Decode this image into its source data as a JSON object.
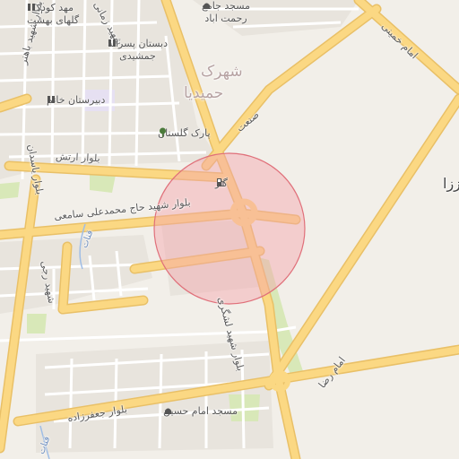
{
  "map": {
    "colors": {
      "background": "#f2efe9",
      "block": "#e8e4dd",
      "road_major": "#fbd883",
      "road_major_casing": "#e9c067",
      "road_minor": "#ffffff",
      "park": "#d8e8b8",
      "school": "#e6e0f2",
      "search_circle_fill": "#f4a3ab",
      "search_circle_stroke": "#e0707a"
    },
    "roads": {
      "artesh": "بلوار ارتش",
      "samei": "بلوار شهید حاج محمدعلی سامعی",
      "lashgari": "بلوار شهید لشگری",
      "jafarzadeh": "بلوار جعفرزاده",
      "imam_reza": "امام رضا",
      "imam_khomeini": "امام خمینی",
      "sanat": "صنعت",
      "bahonar": "بلوار شهید باهنر",
      "yasdan": "بلوار یاسدان",
      "shahid_raji": "شهید رجی",
      "shahid_zamani": "شهید زمانی"
    },
    "areas": {
      "shahrak_line1": "شهرک",
      "shahrak_line2": "حمیدیا",
      "edge": "ززا"
    },
    "water": {
      "canal": "قنات",
      "canal2": "قنات"
    },
    "pois": {
      "kindergarten": {
        "line1": "مهد کودک",
        "line2": "گلهای بهشت",
        "icon": "school-icon"
      },
      "school_boys": {
        "line1": "دبستان پسرانه",
        "line2": "جمشیدی",
        "icon": "school-icon"
      },
      "school_khatam": {
        "line1": "دبیرستان خاتم",
        "icon": "school-icon"
      },
      "mosque_jame": {
        "line1": "مسجد جامع",
        "line2": "رحمت اباد",
        "icon": "mosque-icon"
      },
      "park_golestan": {
        "line1": "پارک گلستان",
        "icon": "tree-icon"
      },
      "gas": {
        "line1": "گاز",
        "icon": "fuel-icon"
      },
      "mosque_imam": {
        "line1": "مسجد امام حسین",
        "icon": "mosque-icon"
      }
    }
  }
}
